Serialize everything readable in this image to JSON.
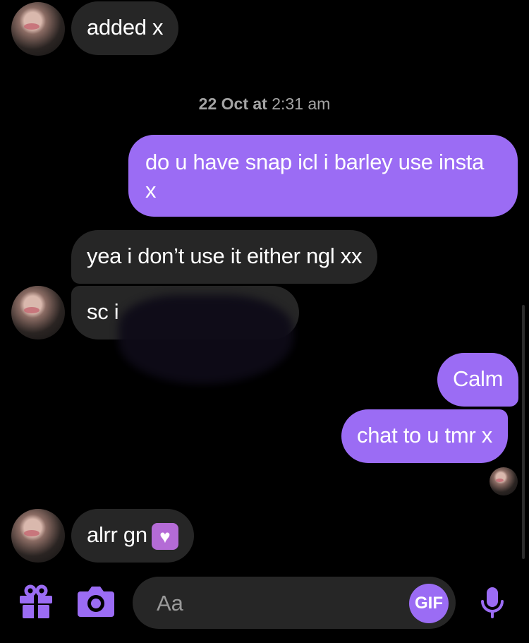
{
  "messages": {
    "m1": "added x",
    "timestamp_date": "22 Oct at",
    "timestamp_time": "2:31 am",
    "m2_line1": "do u have snap icl i barley use insta",
    "m2_line2": "x",
    "m3": "yea i don’t use it either ngl xx",
    "m4": "sc i",
    "m5": "Calm",
    "m6": "chat to u tmr x",
    "m7": "alrr gn"
  },
  "composer": {
    "placeholder": "Aa",
    "gif_label": "GIF"
  },
  "icons": {
    "gift": "gift-icon",
    "camera": "camera-icon",
    "mic": "microphone-icon",
    "heart": "purple-heart-emoji"
  },
  "colors": {
    "accent": "#9b6cf4",
    "incoming_bubble": "#262626",
    "background": "#000000"
  }
}
